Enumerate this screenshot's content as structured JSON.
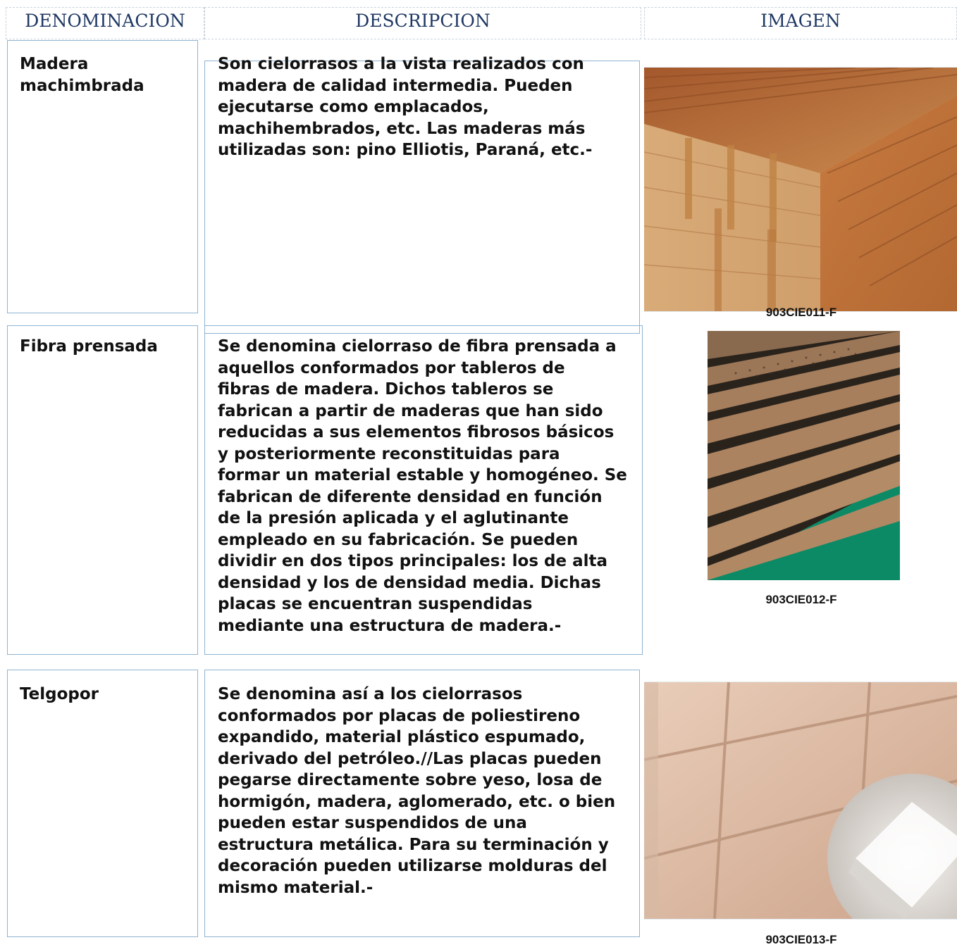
{
  "header": {
    "col_name": "DENOMINACION",
    "col_desc": "DESCRIPCION",
    "col_image": "IMAGEN"
  },
  "rows": [
    {
      "name": "Madera\nmachimbrada",
      "description": "Son cielorrasos a la vista realizados con\nmadera de calidad intermedia. Pueden\nejecutarse como emplacados,\nmachihembrados, etc. Las maderas más\nutilizadas son: pino Elliotis, Paraná, etc.-",
      "image_code": "903CIE011-F",
      "image_subject": "wood-ceiling-photo"
    },
    {
      "name": "Fibra prensada",
      "description": "Se denomina cielorraso de fibra prensada a\naquellos conformados por tableros de\nfibras de madera. Dichos tableros se\nfabrican a partir de maderas que han sido\nreducidas a sus elementos fibrosos básicos\ny posteriormente reconstituidas para\nformar un material estable y homogéneo. Se\nfabrican de diferente densidad en función\nde la presión aplicada y el aglutinante\nempleado en su fabricación. Se pueden\ndividir en dos tipos principales: los de alta\ndensidad y los de densidad media. Dichas\nplacas se encuentran suspendidas\nmediante una estructura de madera.-",
      "image_code": "903CIE012-F",
      "image_subject": "fiberboard-stack-photo"
    },
    {
      "name": "Telgopor",
      "description": "Se denomina así a los cielorrasos\nconformados por placas de poliestireno\nexpandido, material plástico espumado,\nderivado del petróleo.//Las placas pueden\npegarse directamente sobre yeso, losa de\nhormigón, madera, aglomerado, etc. o bien\npueden estar suspendidos de una\nestructura metálica. Para su terminación y\ndecoración pueden utilizarse molduras del\nmismo material.-",
      "image_code": "903CIE013-F",
      "image_subject": "polystyrene-tiles-photo"
    }
  ],
  "colors": {
    "header_text": "#1f3864",
    "box_border": "#8fb3d2",
    "fiber_background": "#0c8a66"
  }
}
